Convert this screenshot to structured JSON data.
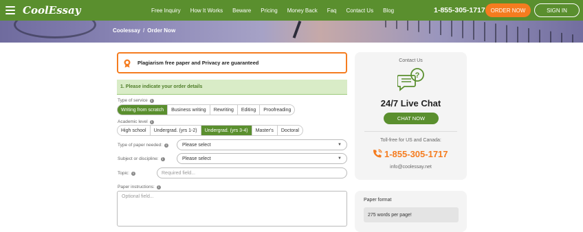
{
  "nav": {
    "logo": "CoolEssay",
    "links": [
      "Free Inquiry",
      "How It Works",
      "Beware",
      "Pricing",
      "Money Back",
      "Faq",
      "Contact Us",
      "Blog"
    ],
    "phone": "1-855-305-1717",
    "order_label": "ORDER NOW",
    "signin_label": "SIGN IN"
  },
  "breadcrumb": {
    "home": "Coolessay",
    "separator": "/",
    "current": "Order Now"
  },
  "guarantee": {
    "text": "Plagiarism free paper and Privacy are guaranteed"
  },
  "form": {
    "section_title": "1. Please indicate your order details",
    "service": {
      "label": "Type of service",
      "options": [
        "Writing from scratch",
        "Business writing",
        "Rewriting",
        "Editing",
        "Proofreading"
      ],
      "selected": "Writing from scratch"
    },
    "academic": {
      "label": "Academic level",
      "options": [
        "High school",
        "Undergrad. (yrs 1-2)",
        "Undergrad. (yrs 3-4)",
        "Master's",
        "Doctoral"
      ],
      "selected": "Undergrad. (yrs 3-4)"
    },
    "paper_type": {
      "label": "Type of paper needed:",
      "value": "Please select"
    },
    "subject": {
      "label": "Subject or discipline:",
      "value": "Please select"
    },
    "topic": {
      "label": "Topic:",
      "placeholder": "Required field..."
    },
    "instructions": {
      "label": "Paper instructions:",
      "placeholder": "Optional field..."
    }
  },
  "contact_card": {
    "title": "Contact Us",
    "heading": "24/7 Live Chat",
    "chat_label": "CHAT NOW",
    "tollfree": "Toll-free for US and Canada:",
    "phone": "1-855-305-1717",
    "email": "info@coolessay.net"
  },
  "format_card": {
    "title": "Paper format",
    "value": "275 words per page!"
  },
  "colors": {
    "brand_green": "#5a8f2e",
    "accent_orange": "#f57c1f"
  }
}
